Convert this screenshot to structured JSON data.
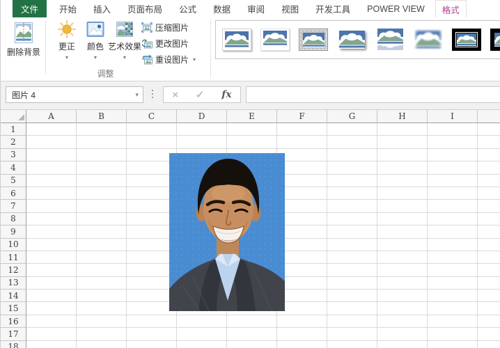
{
  "tabs": {
    "file": "文件",
    "items": [
      "开始",
      "插入",
      "页面布局",
      "公式",
      "数据",
      "审阅",
      "视图",
      "开发工具",
      "POWER VIEW",
      "格式"
    ],
    "active": "格式"
  },
  "colors": {
    "excel_green": "#217346",
    "contextual_tab_pink": "#B43E8F",
    "photo_background_blue": "#4A8CD2",
    "suit_gray": "#42444C",
    "shirt_blue": "#BCD3EE"
  },
  "ribbon": {
    "adjust": {
      "label": "调整",
      "remove_background": "删除背景",
      "corrections": "更正",
      "color": "颜色",
      "artistic_effects": "艺术效果",
      "compress_picture": "压缩图片",
      "change_picture": "更改图片",
      "reset_picture": "重设图片"
    },
    "gallery": {
      "styles": [
        "simple-frame-white",
        "beveled-matte-white",
        "metal-frame",
        "drop-shadow-rectangle",
        "reflected-rounded-rectangle",
        "soft-edge-rectangle",
        "double-frame-black",
        "thick-frame-black"
      ]
    }
  },
  "formula_bar": {
    "name_box": "图片 4",
    "fx_label": "fx",
    "formula": ""
  },
  "icons": {
    "dropdown": "▾",
    "cancel": "×",
    "enter": "✓"
  },
  "grid": {
    "columns": [
      "A",
      "B",
      "C",
      "D",
      "E",
      "F",
      "G",
      "H",
      "I"
    ],
    "rows": [
      "1",
      "2",
      "3",
      "4",
      "5",
      "6",
      "7",
      "8",
      "9",
      "10",
      "11",
      "12",
      "13",
      "14",
      "15",
      "16",
      "17",
      "18"
    ]
  }
}
